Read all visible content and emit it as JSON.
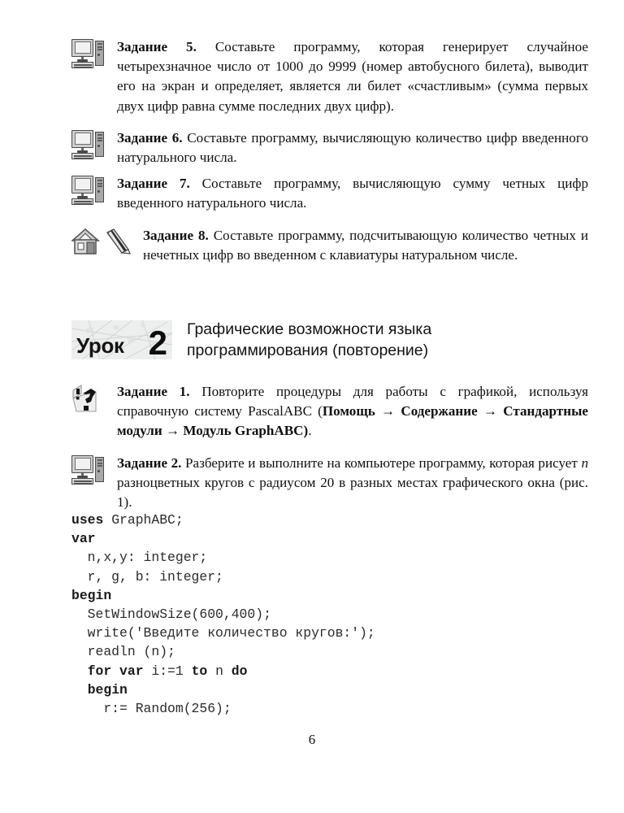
{
  "page": {
    "number": "6",
    "language": "ru"
  },
  "tasks": [
    {
      "id": "task-5",
      "icons": [
        "computer-icon"
      ],
      "label": "Задание 5.",
      "text": " Составьте программу, которая генерирует случайное четырехзначное число от 1000 до 9999 (номер автобусного билета), выводит его на экран и определяет, является ли билет «счастливым» (сумма первых двух цифр равна сумме последних двух цифр)."
    },
    {
      "id": "task-6",
      "icons": [
        "computer-icon"
      ],
      "label": "Задание 6.",
      "text": " Составьте программу, вычисляющую количество цифр введенного натурального числа."
    },
    {
      "id": "task-7",
      "icons": [
        "computer-icon"
      ],
      "label": "Задание 7.",
      "text": " Составьте программу, вычисляющую сумму четных цифр введенного натурального числа."
    },
    {
      "id": "task-8",
      "icons": [
        "house-icon",
        "pencil-icon"
      ],
      "label": "Задание 8.",
      "text": " Составьте программу, подсчитывающую количество четных и нечетных цифр во введенном с клавиатуры натуральном числе."
    }
  ],
  "lesson": {
    "badge_label": "Урок",
    "badge_number": "2",
    "title_line1": "Графические возможности языка",
    "title_line2": "программирования (повторение)"
  },
  "lesson_tasks": [
    {
      "id": "lesson-task-1",
      "icons": [
        "question-mark-icon"
      ],
      "label": "Задание 1.",
      "text_before": " Повторите процедуры для работы с графикой, используя справочную систему PascalABC (",
      "menu_path": "Помощь → Содержание → Стандартные модули → Модуль GraphABC)",
      "text_after": "."
    },
    {
      "id": "lesson-task-2",
      "icons": [
        "computer-icon"
      ],
      "label": "Задание 2.",
      "text_part1": " Разберите и выполните на компьютере программу, которая рисует ",
      "italic_var": "n",
      "text_part2": " разноцветных кругов с радиусом 20 в разных местах графического окна (рис. 1)."
    }
  ],
  "code": {
    "language": "pascal",
    "lines": [
      {
        "indent": 0,
        "keyword": "uses",
        "rest": " GraphABC;"
      },
      {
        "indent": 0,
        "keyword": "var",
        "rest": ""
      },
      {
        "indent": 2,
        "keyword": "",
        "rest": "n,x,y: integer;"
      },
      {
        "indent": 2,
        "keyword": "",
        "rest": "r, g, b: integer;"
      },
      {
        "indent": 0,
        "keyword": "begin",
        "rest": ""
      },
      {
        "indent": 2,
        "keyword": "",
        "rest": "SetWindowSize(600,400);"
      },
      {
        "indent": 2,
        "keyword": "",
        "rest": "write('Введите количество кругов:');"
      },
      {
        "indent": 2,
        "keyword": "",
        "rest": "readln (n);"
      },
      {
        "indent": 2,
        "keyword": "for var",
        "rest": " i:=1 ",
        "keyword2": "to",
        "rest2": " n ",
        "keyword3": "do",
        "rest3": ""
      },
      {
        "indent": 2,
        "keyword": "begin",
        "rest": ""
      },
      {
        "indent": 4,
        "keyword": "",
        "rest": "r:= Random(256);"
      }
    ]
  }
}
